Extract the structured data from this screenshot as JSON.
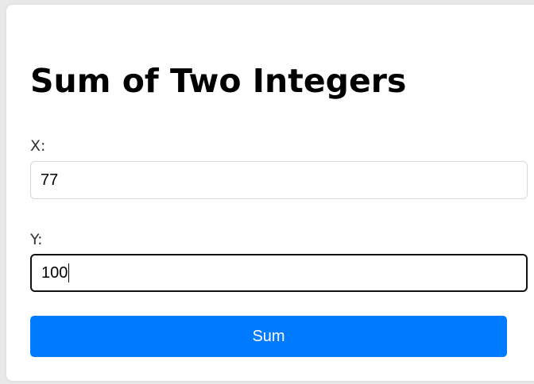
{
  "form": {
    "title": "Sum of Two Integers",
    "x_label": "X:",
    "x_value": "77",
    "y_label": "Y:",
    "y_value": "100",
    "submit_label": "Sum"
  },
  "colors": {
    "accent": "#007bff",
    "focused_border": "#111111"
  }
}
